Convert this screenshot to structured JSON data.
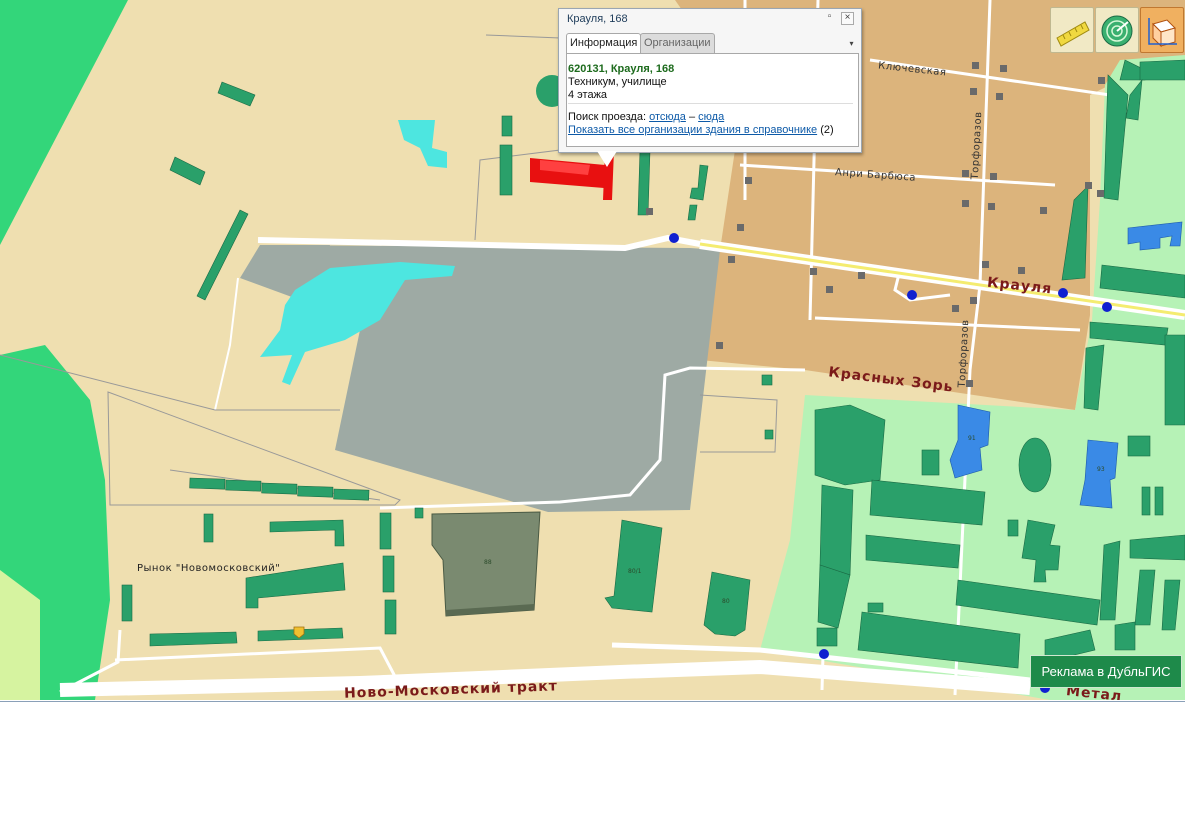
{
  "popup": {
    "title": "Крауля, 168",
    "tabs": [
      "Информация",
      "Организации"
    ],
    "address": "620131, Крауля, 168",
    "type": "Техникум, училище",
    "floors": "4 этажа",
    "route_prefix": "Поиск проезда:",
    "route_from": "отсюда",
    "route_dash": "–",
    "route_to": "сюда",
    "show_orgs": "Показать все организации здания в справочнике",
    "orgs_count": "(2)"
  },
  "map": {
    "streets": {
      "kraulya": "Крауля",
      "krasnyh_zor": "Красных Зорь",
      "novo_moskovsky": "Ново-Московский тракт",
      "metall": "Метал",
      "klyuchevskaya": "Ключевская",
      "anri_barbyusa": "Анри Барбюса",
      "torforazov1": "Торфоразов",
      "torforazov2": "Торфоразов"
    },
    "places": {
      "market": "Рынок \"Новомосковский\""
    },
    "building_numbers": {
      "b88": "88",
      "b80_1": "80/1",
      "b80": "80",
      "b91": "91",
      "b93": "93"
    }
  },
  "toolbar": {
    "ruler": "ruler-icon",
    "radar": "radar-icon",
    "view3d": "cube-3d-icon"
  },
  "ad_label": "Реклама в ДубльГИС",
  "colors": {
    "land": "#efdfb0",
    "private_sector": "#dcb47c",
    "greenzone": "#b6f2b6",
    "park": "#33d67a",
    "water": "#4de6e0",
    "industrial": "#9eaaa4",
    "building": "#2aa06a",
    "selected_building": "#e81010",
    "accent": "#1e8a4a"
  }
}
